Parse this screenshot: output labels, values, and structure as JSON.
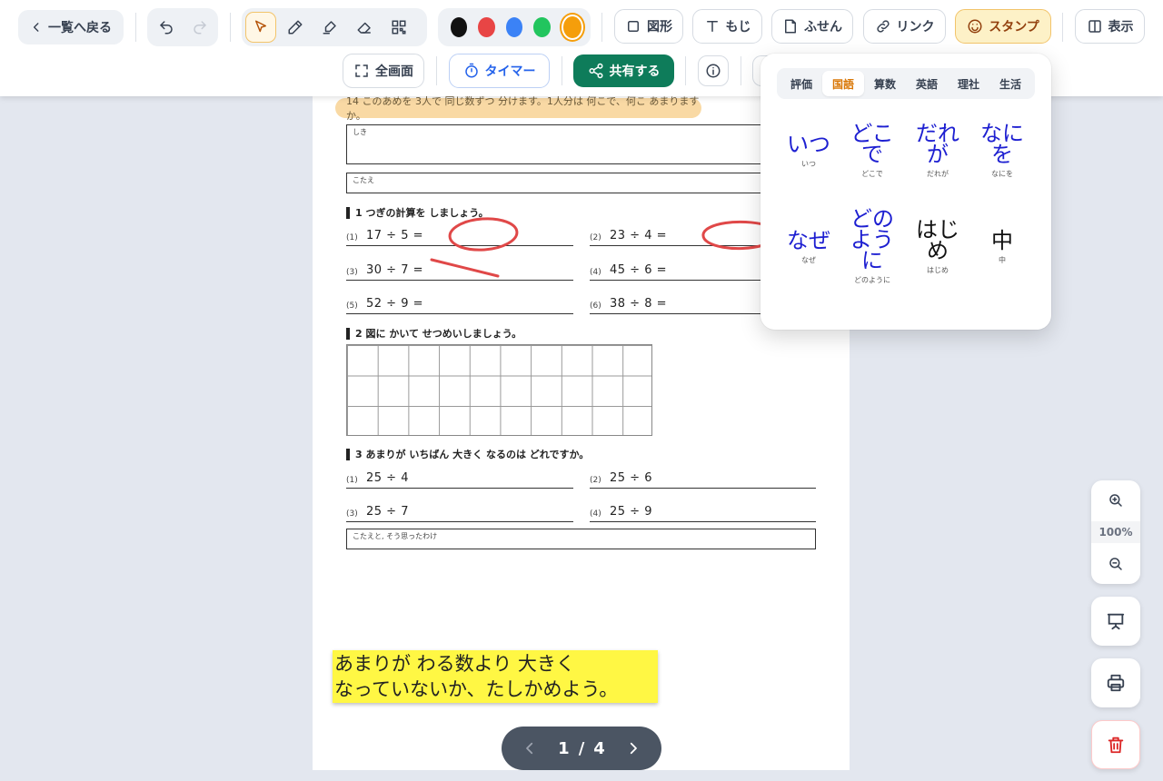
{
  "toolbar": {
    "back_label": "一覧へ戻る",
    "shape_label": "図形",
    "text_label": "もじ",
    "sticky_label": "ふせん",
    "link_label": "リンク",
    "stamp_label": "スタンプ",
    "view_label": "表示",
    "fullscreen_label": "全画面",
    "timer_label": "タイマー",
    "share_label": "共有する",
    "colors": [
      "#111111",
      "#e84545",
      "#3b82f6",
      "#22c55e",
      "#f59e0b"
    ],
    "accent_color": "#f59e0b",
    "share_color": "#0e7c5a"
  },
  "worksheet": {
    "banner": "14 このあめを 3人で 同じ数ずつ 分けます。1人分は 何こで、何こ あまりますか。",
    "shiki_label": "しき",
    "kotae_label": "こたえ",
    "section1": "1 つぎの計算を しましょう。",
    "problems1": [
      {
        "num": "(1)",
        "expr": "17 ÷ 5 ="
      },
      {
        "num": "(2)",
        "expr": "23 ÷ 4 ="
      },
      {
        "num": "(3)",
        "expr": "30 ÷ 7 ="
      },
      {
        "num": "(4)",
        "expr": "45 ÷ 6 ="
      },
      {
        "num": "(5)",
        "expr": "52 ÷ 9 ="
      },
      {
        "num": "(6)",
        "expr": "38 ÷ 8 ="
      }
    ],
    "section2": "2 図に かいて せつめいしましょう。",
    "section3": "3 あまりが いちばん 大きく なるのは どれですか。",
    "problems3": [
      {
        "num": "(1)",
        "expr": "25 ÷ 4"
      },
      {
        "num": "(2)",
        "expr": "25 ÷ 6"
      },
      {
        "num": "(3)",
        "expr": "25 ÷ 7"
      },
      {
        "num": "(4)",
        "expr": "25 ÷ 9"
      }
    ],
    "reason_label": "こたえと, そう思ったわけ",
    "sticky_line1": "あまりが わる数より 大きく",
    "sticky_line2": "なっていないか、たしかめよう。"
  },
  "stamp_popup": {
    "tabs": [
      "評価",
      "国語",
      "算数",
      "英語",
      "理社",
      "生活"
    ],
    "active_tab": "国語",
    "stamps": [
      {
        "big": "いつ",
        "small": "いつ",
        "color": "blue"
      },
      {
        "big": "どこで",
        "small": "どこで",
        "color": "blue"
      },
      {
        "big": "だれが",
        "small": "だれが",
        "color": "blue"
      },
      {
        "big": "なにを",
        "small": "なにを",
        "color": "blue"
      },
      {
        "big": "なぜ",
        "small": "なぜ",
        "color": "blue"
      },
      {
        "big": "どのように",
        "small": "どのように",
        "color": "blue"
      },
      {
        "big": "はじめ",
        "small": "はじめ",
        "color": "black"
      },
      {
        "big": "中",
        "small": "中",
        "color": "black"
      }
    ]
  },
  "zoom": {
    "level": "100%"
  },
  "pager": {
    "current": "1",
    "separator": "/",
    "total": "4"
  }
}
